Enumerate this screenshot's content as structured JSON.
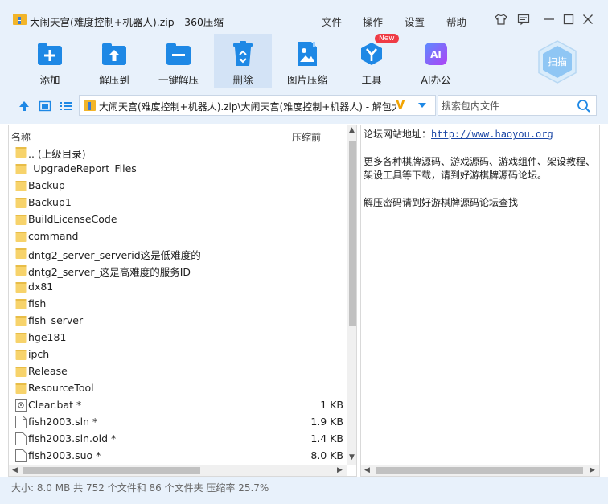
{
  "window": {
    "title": "大闹天宫(难度控制+机器人).zip - 360压缩",
    "menu": [
      "文件",
      "操作",
      "设置",
      "帮助"
    ]
  },
  "toolbar": {
    "add": "添加",
    "extract_to": "解压到",
    "one_click_extract": "一键解压",
    "delete": "删除",
    "image_compress": "图片压缩",
    "tools": "工具",
    "tools_badge": "New",
    "ai_office": "AI办公",
    "scan": "扫描"
  },
  "address": {
    "path": "大闹天宫(难度控制+机器人).zip\\大闹天宫(难度控制+机器人) - 解包大小为",
    "vip_mark": "V"
  },
  "search": {
    "placeholder": "搜索包内文件"
  },
  "list": {
    "col_name": "名称",
    "col_size": "压缩前",
    "rows": [
      {
        "name": ".. (上级目录)",
        "size": "",
        "icon": "folder-icon"
      },
      {
        "name": "_UpgradeReport_Files",
        "size": "",
        "icon": "folder-icon"
      },
      {
        "name": "Backup",
        "size": "",
        "icon": "folder-icon"
      },
      {
        "name": "Backup1",
        "size": "",
        "icon": "folder-icon"
      },
      {
        "name": "BuildLicenseCode",
        "size": "",
        "icon": "folder-icon"
      },
      {
        "name": "command",
        "size": "",
        "icon": "folder-icon"
      },
      {
        "name": "dntg2_server_serverid这是低难度的",
        "size": "",
        "icon": "folder-icon"
      },
      {
        "name": "dntg2_server_这是高难度的服务ID",
        "size": "",
        "icon": "folder-icon"
      },
      {
        "name": "dx81",
        "size": "",
        "icon": "folder-icon"
      },
      {
        "name": "fish",
        "size": "",
        "icon": "folder-icon"
      },
      {
        "name": "fish_server",
        "size": "",
        "icon": "folder-icon"
      },
      {
        "name": "hge181",
        "size": "",
        "icon": "folder-icon"
      },
      {
        "name": "ipch",
        "size": "",
        "icon": "folder-icon"
      },
      {
        "name": "Release",
        "size": "",
        "icon": "folder-icon"
      },
      {
        "name": "ResourceTool",
        "size": "",
        "icon": "folder-icon"
      },
      {
        "name": "Clear.bat *",
        "size": "1 KB",
        "icon": "batch-file-icon"
      },
      {
        "name": "fish2003.sln *",
        "size": "1.9 KB",
        "icon": "file-icon"
      },
      {
        "name": "fish2003.sln.old *",
        "size": "1.4 KB",
        "icon": "file-icon"
      },
      {
        "name": "fish2003.suo *",
        "size": "8.0 KB",
        "icon": "file-icon"
      }
    ]
  },
  "comment": {
    "line1_label": "论坛网站地址：",
    "line1_link": "http://www.haoyou.org",
    "line2": "更多各种棋牌源码、游戏源码、游戏组件、架设教程、",
    "line3": "架设工具等下载，请到好游棋牌源码论坛。",
    "line4": "解压密码请到好游棋牌源码论坛查找"
  },
  "status": {
    "text": "大小: 8.0 MB 共 752 个文件和 86 个文件夹 压缩率 25.7%"
  },
  "colors": {
    "accent": "#1e88e5",
    "chrome_bg": "#e8f1fb",
    "folder": "#f7d36b",
    "link": "#1a46a5"
  }
}
